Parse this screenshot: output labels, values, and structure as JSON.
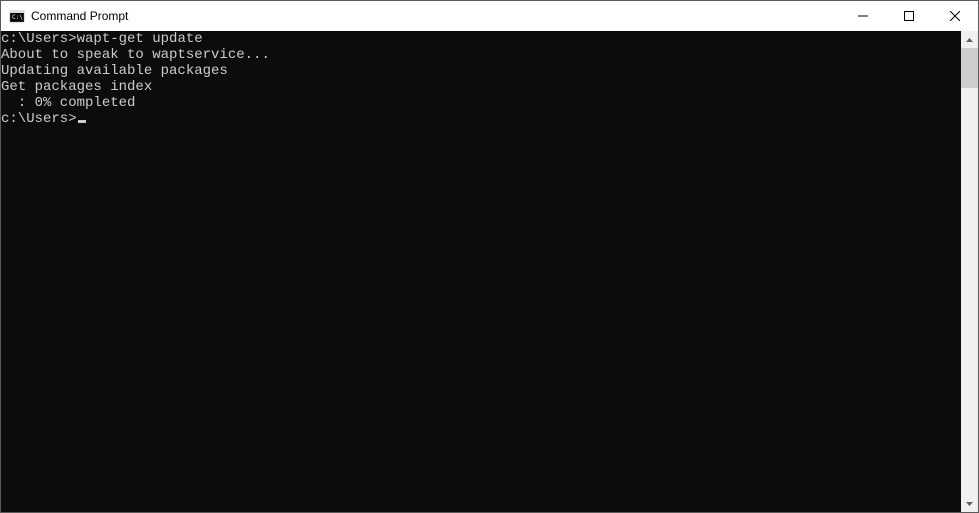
{
  "window": {
    "title": "Command Prompt"
  },
  "terminal": {
    "lines": [
      {
        "prompt": "c:\\Users>",
        "command": "wapt-get update"
      },
      {
        "text": "About to speak to waptservice..."
      },
      {
        "text": "Updating available packages"
      },
      {
        "text": "Get packages index"
      },
      {
        "text": "  : 0% completed"
      }
    ],
    "current_prompt": "c:\\Users>"
  },
  "colors": {
    "terminal_bg": "#0c0c0c",
    "terminal_fg": "#cccccc",
    "window_bg": "#ffffff"
  }
}
